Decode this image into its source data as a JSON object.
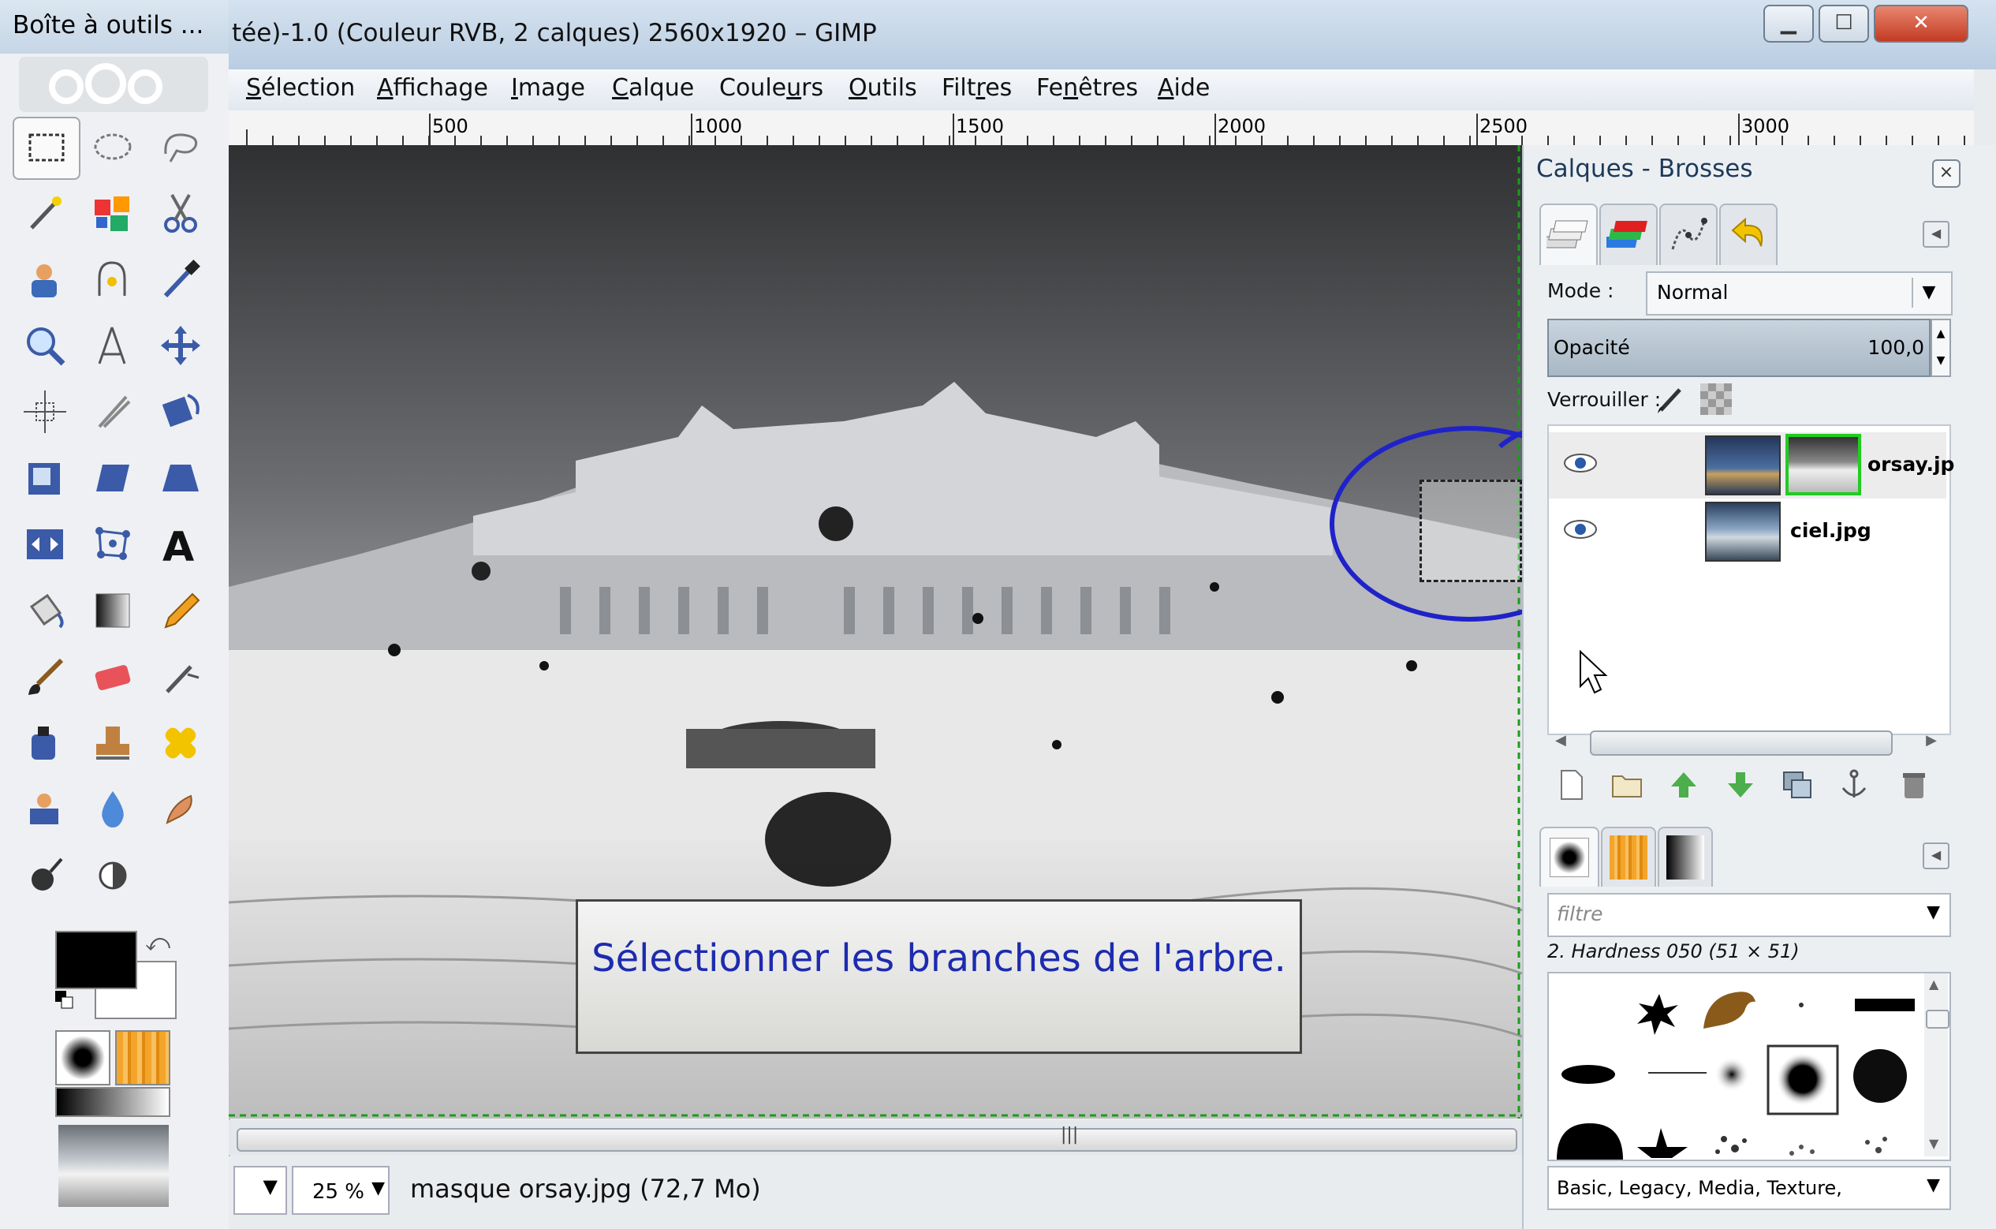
{
  "toolbox": {
    "title": "Boîte à outils ...",
    "tools": [
      "rect-select",
      "ellipse-select",
      "free-select",
      "fuzzy-select",
      "color-select",
      "scissors-select",
      "foreground-select",
      "paths",
      "color-picker",
      "zoom",
      "measure",
      "move",
      "align",
      "crop",
      "rotate",
      "scale",
      "shear",
      "perspective",
      "flip",
      "cage-transform",
      "text",
      "bucket-fill",
      "blend",
      "pencil",
      "paintbrush",
      "eraser",
      "airbrush",
      "ink",
      "clone",
      "heal",
      "perspective-clone",
      "blur",
      "smudge",
      "dodge-burn"
    ]
  },
  "window": {
    "title": "tée)-1.0 (Couleur RVB, 2 calques) 2560x1920 – GIMP"
  },
  "menubar": {
    "items": [
      {
        "pre": "",
        "u": "S",
        "post": "élection"
      },
      {
        "pre": "",
        "u": "A",
        "post": "ffichage"
      },
      {
        "pre": "",
        "u": "I",
        "post": "mage"
      },
      {
        "pre": "",
        "u": "C",
        "post": "alque"
      },
      {
        "pre": "Coule",
        "u": "u",
        "post": "rs"
      },
      {
        "pre": "",
        "u": "O",
        "post": "utils"
      },
      {
        "pre": "Filt",
        "u": "r",
        "post": "es"
      },
      {
        "pre": "Fe",
        "u": "n",
        "post": "êtres"
      },
      {
        "pre": "",
        "u": "A",
        "post": "ide"
      }
    ]
  },
  "ruler": {
    "labels": [
      "500",
      "1000",
      "1500",
      "2000",
      "2500",
      "3000"
    ]
  },
  "canvas": {
    "instruction": "Sélectionner les branches de l'arbre."
  },
  "statusbar": {
    "zoom": "25 %",
    "message": "masque orsay.jpg (72,7 Mo)"
  },
  "dock": {
    "title": "Calques - Brosses",
    "mode_label": "Mode :",
    "mode_value": "Normal",
    "opacity_label": "Opacité",
    "opacity_value": "100,0",
    "lock_label": "Verrouiller :",
    "layers": [
      {
        "name": "orsay.jp",
        "visible": true,
        "has_mask": true
      },
      {
        "name": "ciel.jpg",
        "visible": true,
        "has_mask": false
      }
    ],
    "brush_filter_placeholder": "filtre",
    "brush_name": "2. Hardness 050 (51 × 51)",
    "brush_tags": "Basic, Legacy, Media, Texture,"
  },
  "colors": {
    "annotation": "#1f22c9",
    "instruction_text": "#1d2bb0",
    "active_mask_border": "#22cc22"
  }
}
